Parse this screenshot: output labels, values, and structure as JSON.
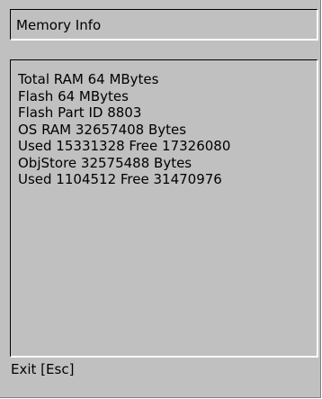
{
  "title": "Memory Info",
  "info_lines": [
    "Total RAM 64 MBytes",
    "Flash 64 MBytes",
    "Flash Part ID 8803",
    "OS RAM 32657408 Bytes",
    "Used 15331328 Free 17326080",
    "ObjStore 32575488 Bytes",
    "Used 1104512 Free 31470976"
  ],
  "footer": {
    "exit_label": "Exit [Esc]"
  },
  "colors": {
    "background": "#c0c0c0",
    "border": "#000000",
    "highlight": "#ffffff"
  }
}
